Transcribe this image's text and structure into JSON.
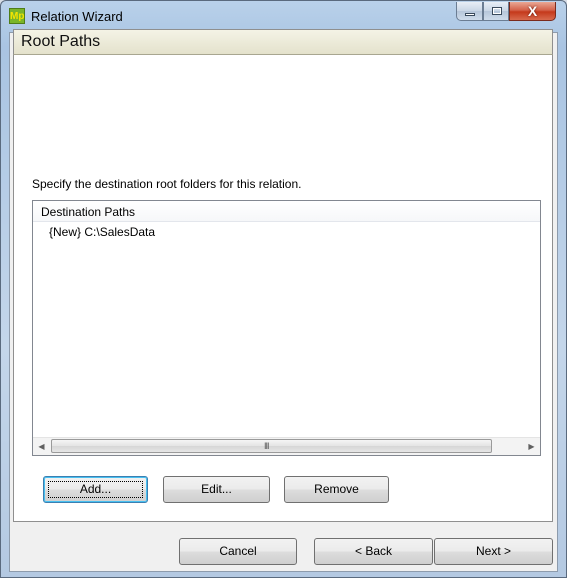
{
  "window": {
    "title": "Relation Wizard",
    "app_icon_text": "Mp",
    "close_glyph": "X"
  },
  "page": {
    "title": "Root Paths",
    "instruction": "Specify the destination root folders for this relation."
  },
  "destination_list": {
    "column_header": "Destination Paths",
    "items": [
      "{New} C:\\SalesData"
    ],
    "scroll_grip": "III"
  },
  "list_buttons": {
    "add_label": "Add...",
    "edit_label": "Edit...",
    "remove_label": "Remove"
  },
  "nav_buttons": {
    "cancel_label": "Cancel",
    "back_label": "< Back",
    "next_label": "Next >"
  },
  "colors": {
    "header_band": "#e4e2cc",
    "close_button": "#c5391b",
    "default_button_border": "#3c7fb1"
  }
}
